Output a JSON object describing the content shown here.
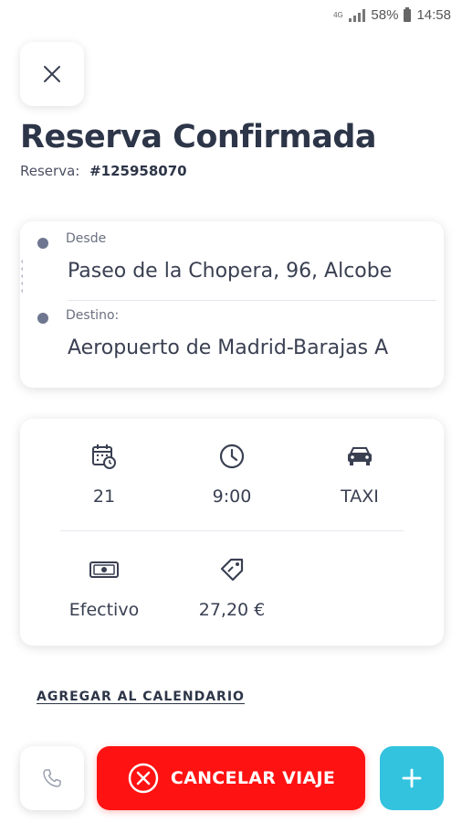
{
  "status_bar": {
    "network": "4G",
    "battery": "58%",
    "time": "14:58"
  },
  "header": {
    "title": "Reserva Confirmada",
    "reserva_label": "Reserva:",
    "reserva_number": "#125958070"
  },
  "route": {
    "from_label": "Desde",
    "from_value": "Paseo de la Chopera, 96, Alcobe",
    "to_label": "Destino:",
    "to_value": "Aeropuerto de Madrid-Barajas A"
  },
  "details": {
    "date": "21",
    "time": "9:00",
    "vehicle": "TAXI",
    "payment": "Efectivo",
    "price": "27,20 €"
  },
  "actions": {
    "add_calendar": "AGREGAR AL CALENDARIO",
    "cancel": "CANCELAR VIAJE"
  },
  "colors": {
    "cancel": "#ff1212",
    "plus": "#33c3de",
    "text_dark": "#2d3548"
  }
}
